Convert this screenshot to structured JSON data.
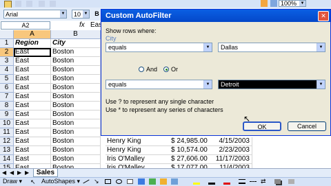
{
  "toolbar": {
    "font_name": "Arial",
    "font_size": "10",
    "bold": "B",
    "zoom": "100%"
  },
  "formula_bar": {
    "name_box": "A2",
    "fx": "fx",
    "content_fragment": "Eas"
  },
  "columns": [
    "A",
    "B"
  ],
  "rows": [
    {
      "num": "1",
      "region": "Region",
      "city": "City"
    },
    {
      "num": "2",
      "region": "East",
      "city": "Boston"
    },
    {
      "num": "3",
      "region": "East",
      "city": "Boston"
    },
    {
      "num": "4",
      "region": "East",
      "city": "Boston"
    },
    {
      "num": "5",
      "region": "East",
      "city": "Boston"
    },
    {
      "num": "6",
      "region": "East",
      "city": "Boston"
    },
    {
      "num": "7",
      "region": "East",
      "city": "Boston"
    },
    {
      "num": "8",
      "region": "East",
      "city": "Boston"
    },
    {
      "num": "9",
      "region": "East",
      "city": "Boston"
    },
    {
      "num": "10",
      "region": "East",
      "city": "Boston"
    },
    {
      "num": "11",
      "region": "East",
      "city": "Boston"
    },
    {
      "num": "12",
      "region": "East",
      "city": "Boston",
      "rep": "Henry King",
      "amount": "$ 24,985.00",
      "date": "4/15/2003"
    },
    {
      "num": "13",
      "region": "East",
      "city": "Boston",
      "rep": "Henry King",
      "amount": "$ 10,574.00",
      "date": "2/23/2003"
    },
    {
      "num": "14",
      "region": "East",
      "city": "Boston",
      "rep": "Iris O'Malley",
      "amount": "$ 27,606.00",
      "date": "11/17/2003"
    },
    {
      "num": "15",
      "region": "East",
      "city": "Boston",
      "rep": "Iris O'Malley",
      "amount": "$ 17,077.00",
      "date": "11/4/2003"
    }
  ],
  "sheet_tab": "Sales",
  "drawbar": {
    "draw": "Draw",
    "autoshapes": "AutoShapes"
  },
  "dialog": {
    "title": "Custom AutoFilter",
    "show_rows": "Show rows where:",
    "field": "City",
    "op1": "equals",
    "val1": "Dallas",
    "and": "And",
    "or": "Or",
    "op2": "equals",
    "val2": "Detroit",
    "hint1": "Use ? to represent any single character",
    "hint2": "Use * to represent any series of characters",
    "ok": "OK",
    "cancel": "Cancel"
  }
}
